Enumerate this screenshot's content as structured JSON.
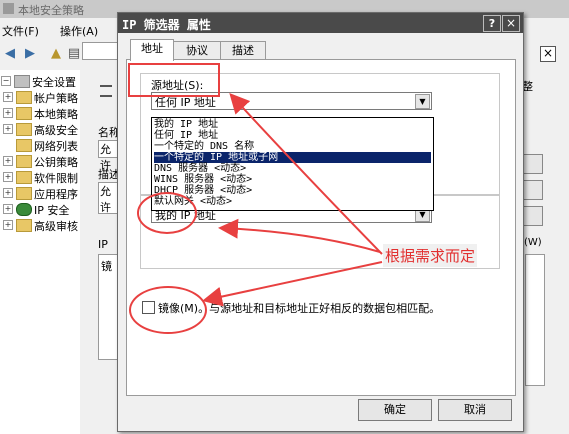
{
  "background_app": {
    "title": "本地安全策略",
    "menus": [
      "文件(F)",
      "操作(A)"
    ],
    "tree_items": [
      {
        "label": "安全设置",
        "expander": "−"
      },
      {
        "label": "帐户策略",
        "expander": "+"
      },
      {
        "label": "本地策略",
        "expander": "+"
      },
      {
        "label": "高级安全",
        "expander": "+"
      },
      {
        "label": "网络列表",
        "expander": ""
      },
      {
        "label": "公钥策略",
        "expander": "+"
      },
      {
        "label": "软件限制",
        "expander": "+"
      },
      {
        "label": "应用程序",
        "expander": "+"
      },
      {
        "label": "IP 安全",
        "expander": "+"
      },
      {
        "label": "高级审核",
        "expander": "+"
      }
    ],
    "inner_labels": {
      "name": "名称",
      "name_value": "允许",
      "desc": "描述",
      "desc_value": "允许",
      "ip": "IP",
      "mirror_col": "镜",
      "right_fragment": "整",
      "right_fragment2": "(W)",
      "close_mark": "×"
    }
  },
  "dialog": {
    "title": "IP 筛选器 属性",
    "help": "?",
    "close": "×",
    "tabs": [
      {
        "label": "地址",
        "active": true
      },
      {
        "label": "协议",
        "active": false
      },
      {
        "label": "描述",
        "active": false
      }
    ],
    "source_group_label": "源地址(S):",
    "source_combo_value": "任何 IP 地址",
    "dropdown_options": [
      {
        "label": "我的 IP 地址",
        "selected": false
      },
      {
        "label": "任何 IP 地址",
        "selected": false
      },
      {
        "label": "一个特定的 DNS 名称",
        "selected": false
      },
      {
        "label": "一个特定的 IP 地址或子网",
        "selected": true
      },
      {
        "label": "DNS 服务器 <动态>",
        "selected": false
      },
      {
        "label": "WINS 服务器 <动态>",
        "selected": false
      },
      {
        "label": "DHCP 服务器 <动态>",
        "selected": false
      },
      {
        "label": "默认网关 <动态>",
        "selected": false
      }
    ],
    "dest_combo_value": "我的 IP 地址",
    "mirror_label": "镜像(M)。与源地址和目标地址正好相反的数据包相匹配。",
    "ok": "确定",
    "cancel": "取消"
  },
  "annotation": {
    "text": "根据需求而定",
    "color": "#e84040"
  }
}
